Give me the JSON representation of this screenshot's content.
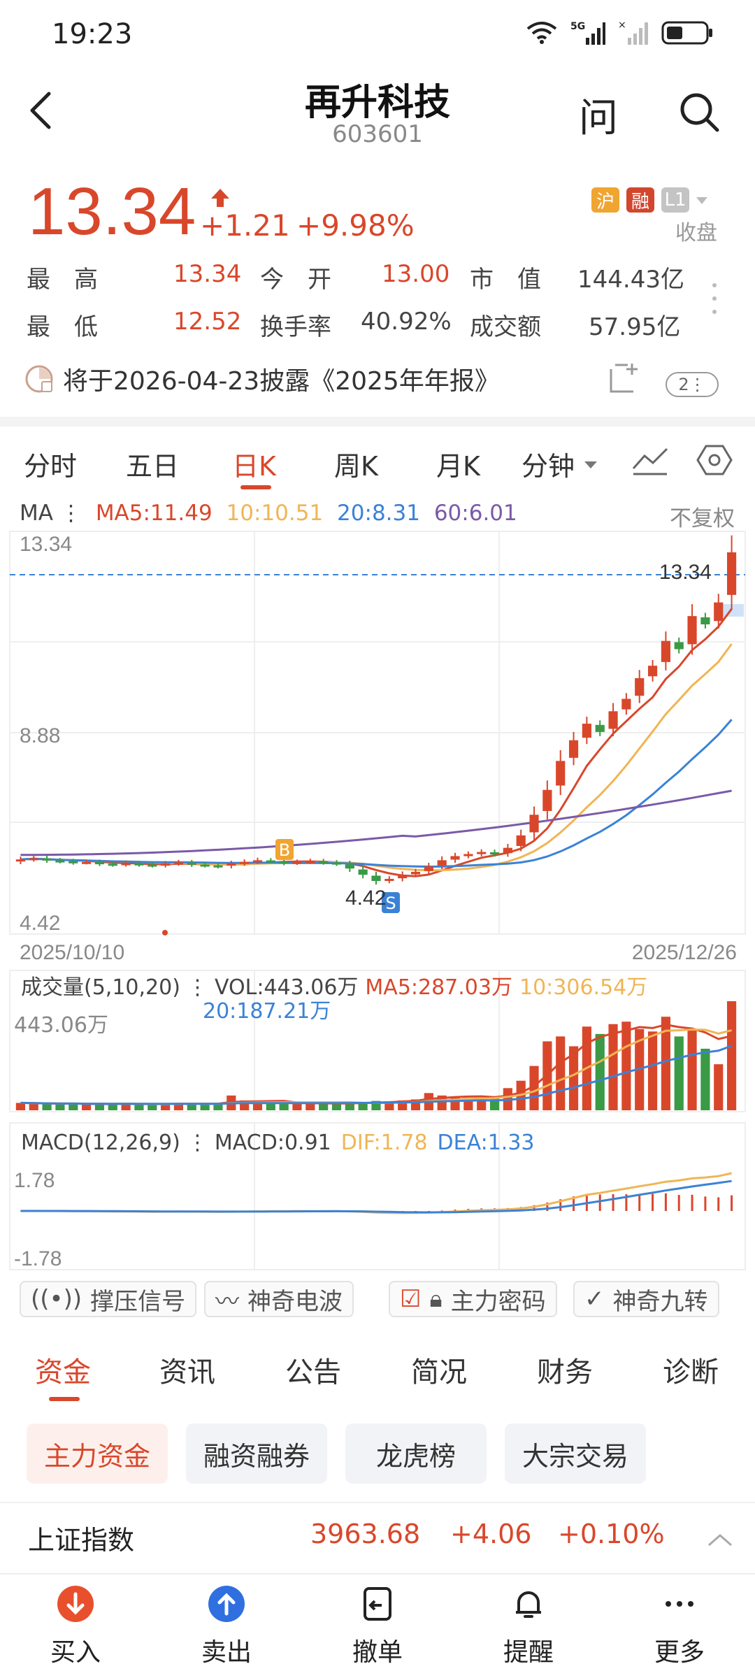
{
  "status_bar": {
    "time": "19:23",
    "network": "5G"
  },
  "header": {
    "title": "再升科技",
    "code": "603601",
    "ask_label": "问"
  },
  "quote": {
    "price": "13.34",
    "change": "+1.21",
    "change_pct": "+9.98%",
    "badges": [
      "沪",
      "融",
      "L1"
    ],
    "market_state": "收盘",
    "rows": [
      [
        {
          "label": "最　高",
          "value": "13.34",
          "red": true
        },
        {
          "label": "今　开",
          "value": "13.00",
          "red": true
        },
        {
          "label": "市　值",
          "value": "144.43亿",
          "red": false
        }
      ],
      [
        {
          "label": "最　低",
          "value": "12.52",
          "red": true
        },
        {
          "label": "换手率",
          "value": "40.92%",
          "red": false
        },
        {
          "label": "成交额",
          "value": "57.95亿",
          "red": false
        }
      ]
    ]
  },
  "notice": {
    "text": "将于2026-04-23披露《2025年年报》",
    "count": "2"
  },
  "chart_tabs": {
    "items": [
      "分时",
      "五日",
      "日K",
      "周K",
      "月K",
      "分钟"
    ],
    "active": "日K"
  },
  "ma_line": {
    "prefix": "MA",
    "ma5": "MA5:11.49",
    "ma10": "10:10.51",
    "ma20": "20:8.31",
    "ma60": "60:6.01",
    "adjust": "不复权"
  },
  "kline": {
    "y_top": "13.34",
    "y_mid": "8.88",
    "y_bottom": "4.42",
    "date_start": "2025/10/10",
    "date_end": "2025/12/26",
    "last_price_label": "13.34",
    "low_label": "4.42",
    "buy_marker": "B",
    "sell_marker": "S"
  },
  "volume": {
    "title": "成交量(5,10,20)",
    "vol": "VOL:443.06万",
    "ma5": "MA5:287.03万",
    "ma10": "10:306.54万",
    "ma20": "20:187.21万",
    "y_top": "443.06万"
  },
  "macd": {
    "title": "MACD(12,26,9)",
    "macd": "MACD:0.91",
    "dif": "DIF:1.78",
    "dea": "DEA:1.33",
    "y_top": "1.78",
    "y_bottom": "-1.78"
  },
  "indicators": [
    "撑压信号",
    "神奇电波",
    "主力密码",
    "神奇九转"
  ],
  "bottom_tabs": {
    "items": [
      "资金",
      "资讯",
      "公告",
      "简况",
      "财务",
      "诊断"
    ],
    "active": "资金"
  },
  "fund_chips": {
    "items": [
      "主力资金",
      "融资融券",
      "龙虎榜",
      "大宗交易"
    ],
    "active": "主力资金"
  },
  "index_bar": {
    "name": "上证指数",
    "value": "3963.68",
    "change": "+4.06",
    "change_pct": "+0.10%"
  },
  "nav": [
    "买入",
    "卖出",
    "撤单",
    "提醒",
    "更多"
  ],
  "colors": {
    "up": "#d9472b",
    "down": "#3a9a45",
    "ma5": "#d9472b",
    "ma10": "#f0b555",
    "ma20": "#3b82d6",
    "ma60": "#7a5aa8"
  },
  "chart_data": {
    "type": "candlestick",
    "x_start": "2025/10/10",
    "x_end": "2025/12/26",
    "ylim": [
      4.42,
      13.34
    ],
    "closes": [
      5.92,
      5.95,
      5.9,
      5.88,
      5.85,
      5.86,
      5.82,
      5.8,
      5.83,
      5.8,
      5.78,
      5.82,
      5.85,
      5.8,
      5.78,
      5.76,
      5.82,
      5.86,
      5.9,
      5.88,
      5.84,
      5.86,
      5.88,
      5.85,
      5.82,
      5.7,
      5.55,
      5.4,
      5.45,
      5.55,
      5.62,
      5.75,
      5.9,
      6.0,
      6.05,
      6.1,
      6.05,
      6.2,
      6.5,
      7.0,
      7.6,
      8.3,
      8.8,
      9.2,
      9.0,
      9.5,
      9.8,
      10.3,
      10.6,
      11.2,
      11.0,
      11.8,
      11.6,
      12.13,
      13.34
    ],
    "volumes_wan": [
      30,
      28,
      26,
      25,
      27,
      24,
      26,
      25,
      28,
      24,
      23,
      26,
      30,
      28,
      25,
      24,
      60,
      40,
      32,
      30,
      28,
      26,
      30,
      28,
      26,
      30,
      34,
      38,
      36,
      40,
      44,
      70,
      60,
      55,
      50,
      48,
      52,
      90,
      120,
      180,
      280,
      300,
      260,
      340,
      310,
      350,
      360,
      330,
      320,
      380,
      300,
      330,
      250,
      187,
      443.06
    ]
  }
}
